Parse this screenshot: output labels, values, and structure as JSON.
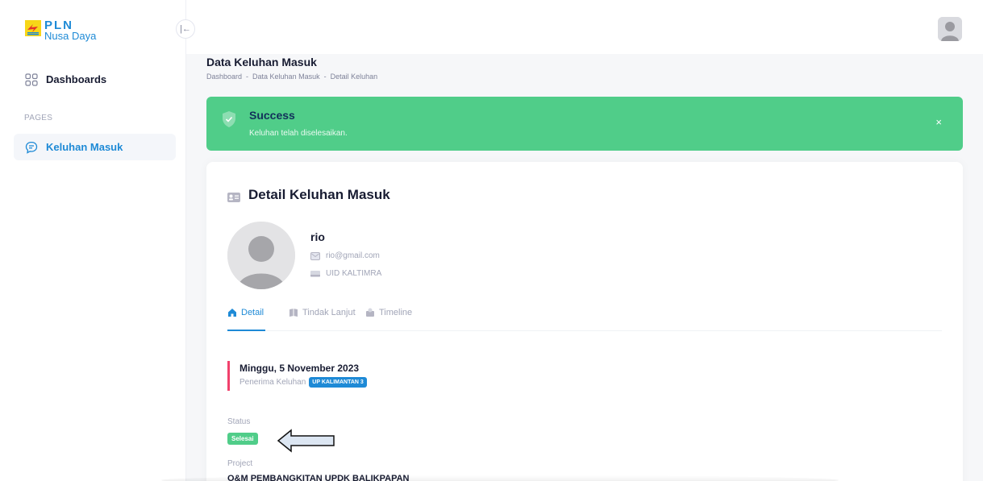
{
  "brand": {
    "name": "PLN",
    "sub": "Nusa Daya"
  },
  "sidebar": {
    "collapse_icon": "|←",
    "dashboard_label": "Dashboards",
    "section_label": "PAGES",
    "active_item_label": "Keluhan Masuk"
  },
  "page": {
    "title": "Data Keluhan Masuk",
    "breadcrumb": [
      "Dashboard",
      "-",
      "Data Keluhan Masuk",
      "-",
      "Detail Keluhan"
    ]
  },
  "alert": {
    "title": "Success",
    "message": "Keluhan telah diselesaikan.",
    "close": "×",
    "color": "#50cd89"
  },
  "detail": {
    "title": "Detail Keluhan Masuk",
    "name": "rio",
    "email": "rio@gmail.com",
    "unit": "UID KALTIMRA",
    "tabs": [
      "Detail",
      "Tindak Lanjut",
      "Timeline"
    ],
    "date": "Minggu, 5 November 2023",
    "receiver_label": "Penerima Keluhan",
    "receiver_badge": "UP KALIMANTAN 3",
    "status_label": "Status",
    "status_value": "Selesai",
    "project_label": "Project",
    "project_value": "O&M PEMBANGKITAN UPDK BALIKPAPAN"
  },
  "colors": {
    "accent": "#1e8ad6",
    "success": "#50cd89",
    "danger": "#f1416c"
  }
}
